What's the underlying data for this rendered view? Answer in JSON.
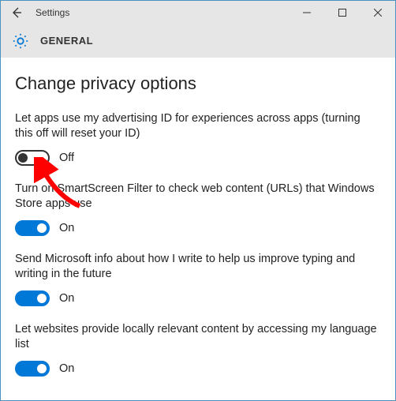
{
  "window": {
    "title": "Settings",
    "section": "GENERAL"
  },
  "page": {
    "heading": "Change privacy options"
  },
  "options": [
    {
      "label": "Let apps use my advertising ID for experiences across apps (turning this off will reset your ID)",
      "state": "Off",
      "on": false
    },
    {
      "label": "Turn on SmartScreen Filter to check web content (URLs) that Windows Store apps use",
      "state": "On",
      "on": true
    },
    {
      "label": "Send Microsoft info about how I write to help us improve typing and writing in the future",
      "state": "On",
      "on": true
    },
    {
      "label": "Let websites provide locally relevant content by accessing my language list",
      "state": "On",
      "on": true
    }
  ],
  "annotation": {
    "type": "arrow",
    "color": "#ff0000",
    "target": "advertising-id-toggle"
  }
}
